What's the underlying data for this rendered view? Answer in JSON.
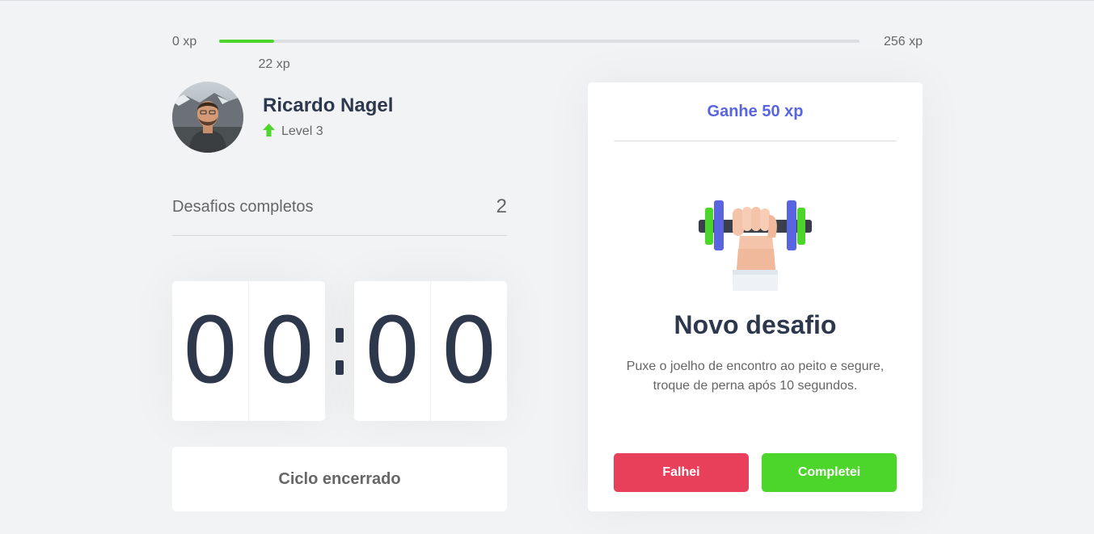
{
  "xp_bar": {
    "min_label": "0 xp",
    "max_label": "256 xp",
    "current_label": "22 xp",
    "current_xp": 22,
    "max_xp": 256,
    "fill_color": "#4cd62b"
  },
  "profile": {
    "name": "Ricardo Nagel",
    "level_label": "Level 3",
    "level_icon": "level-up-arrow-icon"
  },
  "completed_challenges": {
    "label": "Desafios completos",
    "count": "2"
  },
  "countdown": {
    "minute_left": "0",
    "minute_right": "0",
    "separator": ":",
    "second_left": "0",
    "second_right": "0"
  },
  "cycle_button": {
    "label": "Ciclo encerrado"
  },
  "challenge_card": {
    "header": "Ganhe 50 xp",
    "icon": "dumbbell-body-icon",
    "title": "Novo desafio",
    "description": "Puxe o joelho de encontro ao peito e segure, troque de perna após 10 segundos.",
    "fail_label": "Falhei",
    "success_label": "Completei"
  },
  "colors": {
    "background": "#f2f3f5",
    "title_text": "#2e384d",
    "text": "#666666",
    "accent_blue": "#5965e0",
    "red": "#e83f5b",
    "green": "#4cd62b"
  }
}
